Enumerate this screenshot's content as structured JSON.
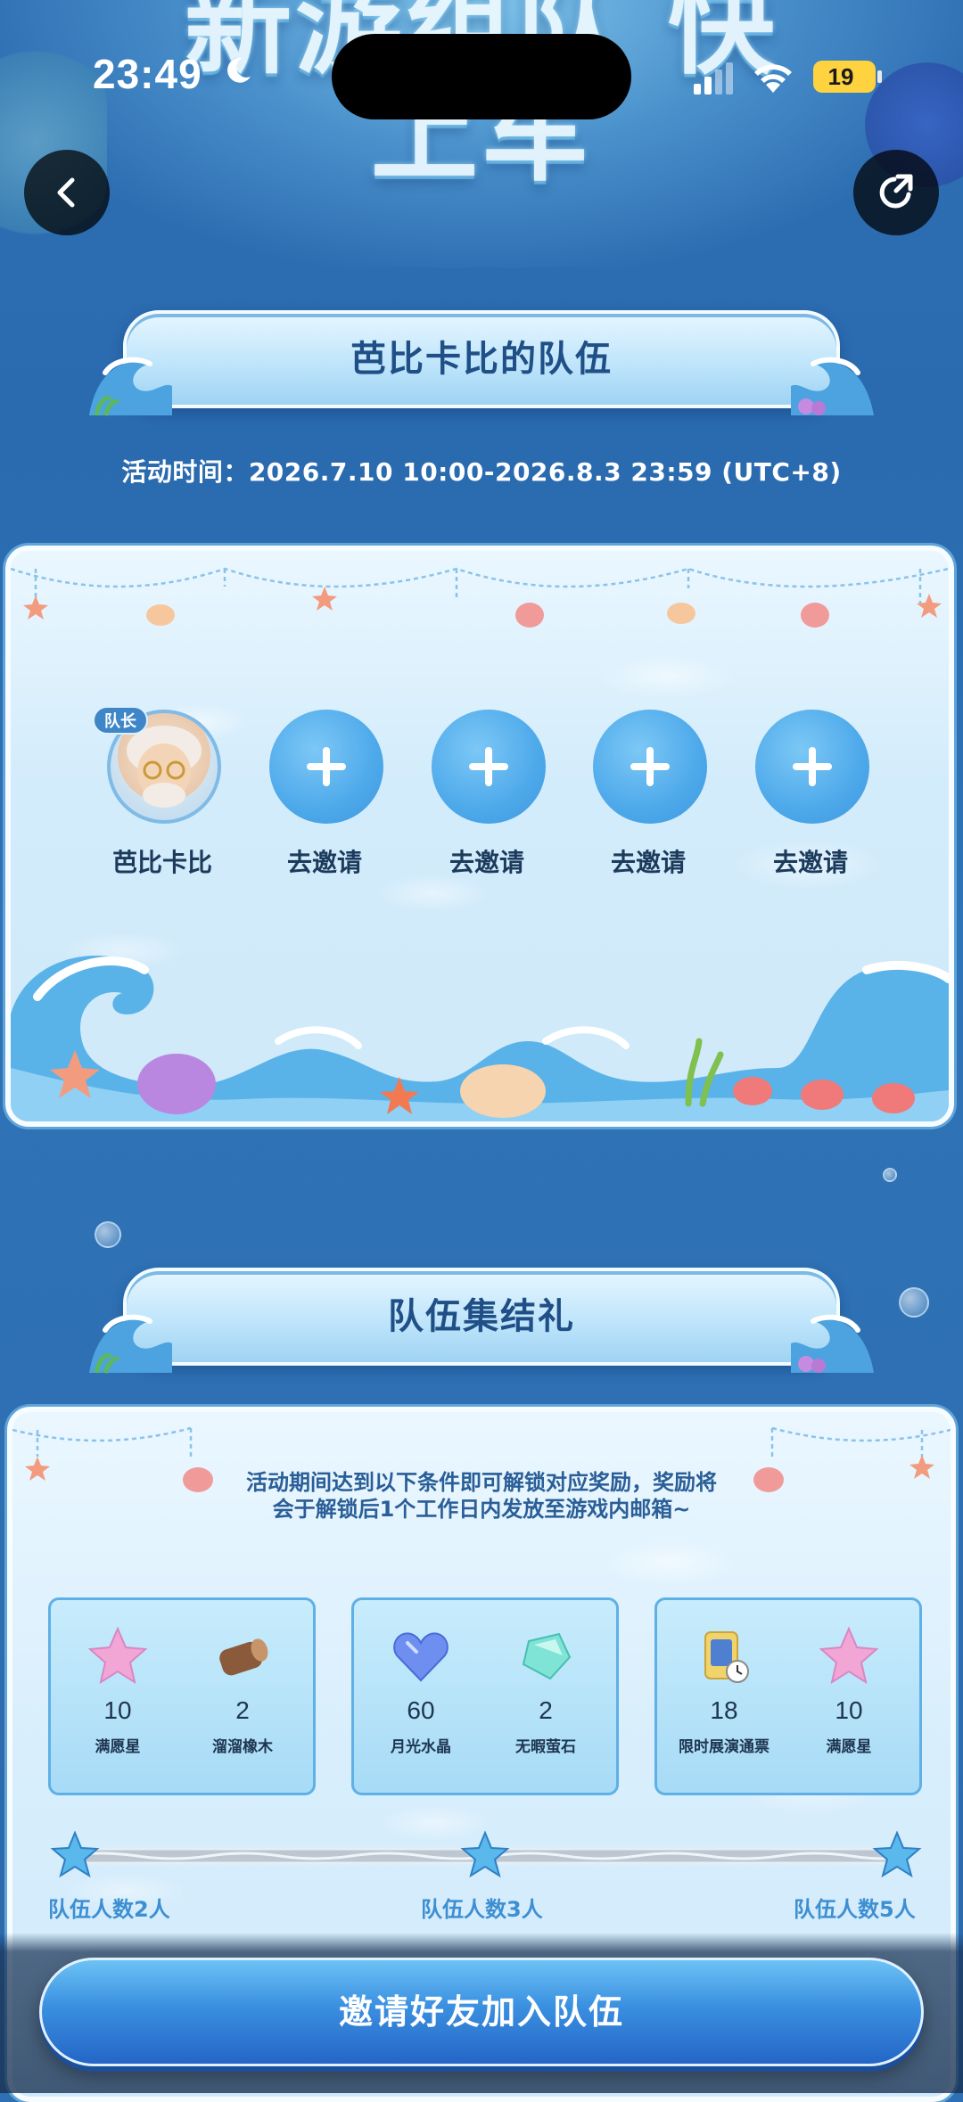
{
  "status_bar": {
    "time": "23:49",
    "battery": "19"
  },
  "header": {
    "title": "新游组队 快上车"
  },
  "team_banner": {
    "title": "芭比卡比的队伍"
  },
  "activity": {
    "time_text": "活动时间：2026.7.10  10:00-2026.8.3  23:59  (UTC+8)"
  },
  "team": {
    "leader_badge": "队长",
    "leader_name": "芭比卡比",
    "invite_label": "去邀请",
    "slots": [
      "去邀请",
      "去邀请",
      "去邀请",
      "去邀请"
    ]
  },
  "reward_banner": {
    "title": "队伍集结礼"
  },
  "rewards": {
    "description_line1": "活动期间达到以下条件即可解锁对应奖励，奖励将",
    "description_line2": "会于解锁后1个工作日内发放至游戏内邮箱~",
    "tiers": [
      {
        "label": "队伍人数2人",
        "items": [
          {
            "qty": "10",
            "name": "满愿星",
            "icon": "star-icon"
          },
          {
            "qty": "2",
            "name": "溜溜橡木",
            "icon": "wood-log-icon"
          }
        ]
      },
      {
        "label": "队伍人数3人",
        "items": [
          {
            "qty": "60",
            "name": "月光水晶",
            "icon": "crystal-heart-icon"
          },
          {
            "qty": "2",
            "name": "无暇萤石",
            "icon": "gem-icon"
          }
        ]
      },
      {
        "label": "队伍人数5人",
        "items": [
          {
            "qty": "18",
            "name": "限时展演通票",
            "icon": "ticket-icon"
          },
          {
            "qty": "10",
            "name": "满愿星",
            "icon": "star-icon"
          }
        ]
      }
    ]
  },
  "cta": {
    "label": "邀请好友加入队伍"
  },
  "colors": {
    "background": "#2f6fb3",
    "panel": "#eaf7ff",
    "accent": "#4ea9ea",
    "cta": "#2f7fd8",
    "text_dark": "#1c3b5c"
  }
}
